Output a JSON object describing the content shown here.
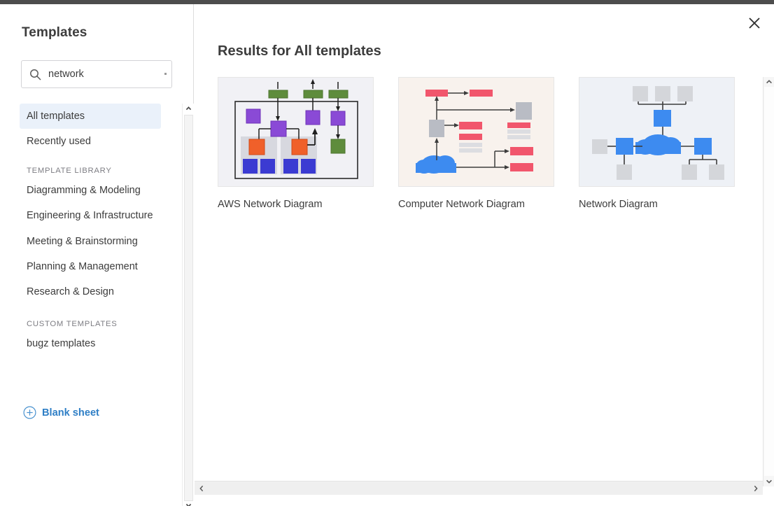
{
  "window": {
    "close_label": "×",
    "close_icon": "close-icon"
  },
  "sidebar": {
    "title": "Templates",
    "search": {
      "value": "network",
      "placeholder": "Search templates",
      "icon": "search-icon",
      "clear_icon": "clear-icon"
    },
    "top_items": [
      {
        "label": "All templates",
        "active": true
      },
      {
        "label": "Recently used",
        "active": false
      }
    ],
    "sections": [
      {
        "heading": "TEMPLATE LIBRARY",
        "items": [
          {
            "label": "Diagramming & Modeling"
          },
          {
            "label": "Engineering & Infrastructure"
          },
          {
            "label": "Meeting & Brainstorming"
          },
          {
            "label": "Planning & Management"
          },
          {
            "label": "Research & Design"
          }
        ]
      },
      {
        "heading": "CUSTOM TEMPLATES",
        "items": [
          {
            "label": "bugz templates"
          }
        ]
      }
    ],
    "blank_sheet": {
      "label": "Blank sheet",
      "icon": "plus-circle-icon"
    },
    "scrollbar": {
      "up_icon": "chevron-up-icon",
      "down_icon": "chevron-down-icon"
    }
  },
  "main": {
    "title": "Results for All templates",
    "cards": [
      {
        "label": "AWS Network Diagram",
        "thumb_class": "thumb-aws",
        "thumb_bg": "#f1f1f5"
      },
      {
        "label": "Computer Network Diagram",
        "thumb_class": "thumb-comp",
        "thumb_bg": "#f8f2ed"
      },
      {
        "label": "Network Diagram",
        "thumb_class": "thumb-net",
        "thumb_bg": "#eef1f6"
      }
    ],
    "scrollbars": {
      "v_up_icon": "chevron-up-icon",
      "v_down_icon": "chevron-down-icon",
      "h_left_icon": "chevron-left-icon",
      "h_right_icon": "chevron-right-icon"
    }
  },
  "palette": {
    "accent_blue": "#2f7fc6",
    "active_row": "#eaf1fa",
    "diagram_green": "#5e8c3c",
    "diagram_purple": "#8a4ad6",
    "diagram_orange": "#f0602a",
    "diagram_blue": "#3b3bd2",
    "diagram_pink": "#f1566c",
    "diagram_gray": "#b9bcc4",
    "diagram_cloud_blue": "#3d8bf0",
    "top_strip": "#4d4d4d"
  }
}
